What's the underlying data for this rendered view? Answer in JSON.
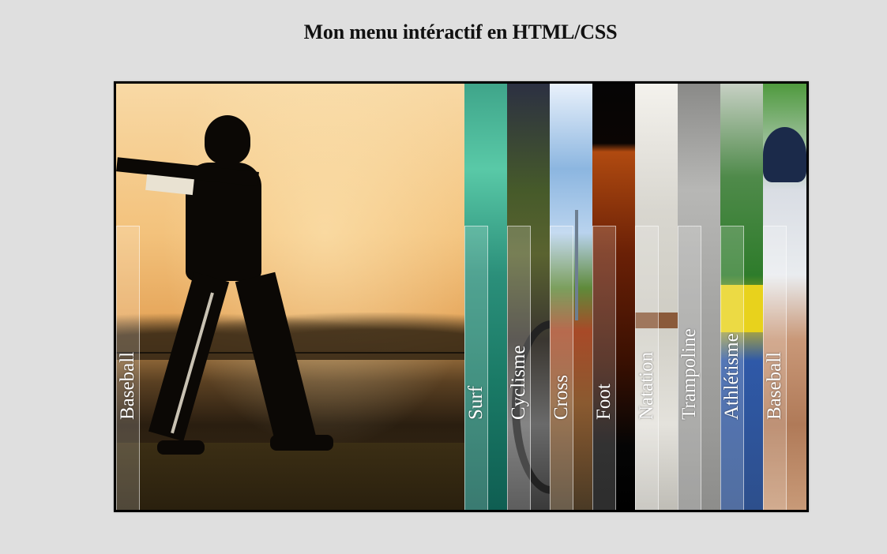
{
  "page": {
    "title": "Mon menu intéractif en HTML/CSS"
  },
  "menu": {
    "items": [
      {
        "label": "Baseball",
        "scene": "baseball-batter-sunset"
      },
      {
        "label": "Surf",
        "scene": "ocean-wave"
      },
      {
        "label": "Cyclisme",
        "scene": "bicycle-wheel"
      },
      {
        "label": "Cross",
        "scene": "motocross-crowd"
      },
      {
        "label": "Foot",
        "scene": "stadium-night"
      },
      {
        "label": "Natation",
        "scene": "swimming-lane"
      },
      {
        "label": "Trampoline",
        "scene": "gym-grey"
      },
      {
        "label": "Athlétisme",
        "scene": "track-stadium"
      },
      {
        "label": "Baseball",
        "scene": "baseball-player-helmet"
      }
    ]
  },
  "colors": {
    "background": "#dfdfdf",
    "frame_border": "#000000",
    "label_text": "#ffffff"
  }
}
